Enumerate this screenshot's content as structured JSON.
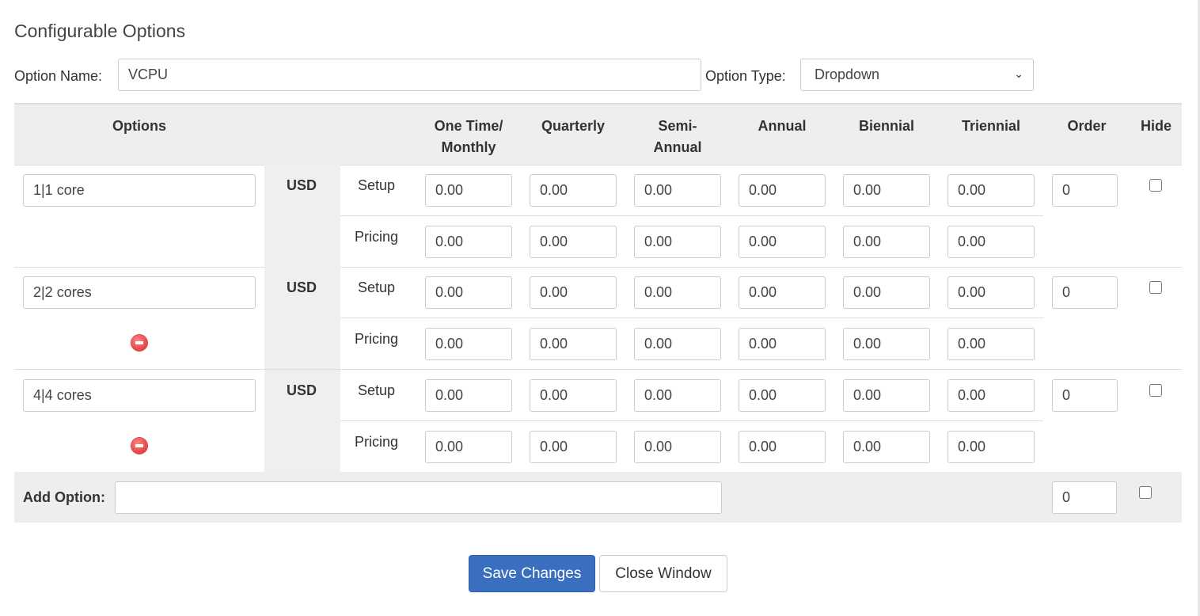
{
  "title": "Configurable Options",
  "option_name_label": "Option Name:",
  "option_name_value": "VCPU",
  "option_type_label": "Option Type:",
  "option_type_value": "Dropdown",
  "headers": {
    "options": "Options",
    "one_time": "One Time/ Monthly",
    "quarterly": "Quarterly",
    "semi": "Semi- Annual",
    "annual": "Annual",
    "biennial": "Biennial",
    "triennial": "Triennial",
    "order": "Order",
    "hide": "Hide"
  },
  "rows": [
    {
      "name": "1|1 core",
      "currency": "USD",
      "setup_label": "Setup",
      "pricing_label": "Pricing",
      "setup": [
        "0.00",
        "0.00",
        "0.00",
        "0.00",
        "0.00",
        "0.00"
      ],
      "pricing": [
        "0.00",
        "0.00",
        "0.00",
        "0.00",
        "0.00",
        "0.00"
      ],
      "order": "0",
      "hide": false,
      "deletable": false
    },
    {
      "name": "2|2 cores",
      "currency": "USD",
      "setup_label": "Setup",
      "pricing_label": "Pricing",
      "setup": [
        "0.00",
        "0.00",
        "0.00",
        "0.00",
        "0.00",
        "0.00"
      ],
      "pricing": [
        "0.00",
        "0.00",
        "0.00",
        "0.00",
        "0.00",
        "0.00"
      ],
      "order": "0",
      "hide": false,
      "deletable": true
    },
    {
      "name": "4|4 cores",
      "currency": "USD",
      "setup_label": "Setup",
      "pricing_label": "Pricing",
      "setup": [
        "0.00",
        "0.00",
        "0.00",
        "0.00",
        "0.00",
        "0.00"
      ],
      "pricing": [
        "0.00",
        "0.00",
        "0.00",
        "0.00",
        "0.00",
        "0.00"
      ],
      "order": "0",
      "hide": false,
      "deletable": true
    }
  ],
  "add_option": {
    "label": "Add Option:",
    "value": "",
    "order": "0",
    "hide": false
  },
  "buttons": {
    "save": "Save Changes",
    "close": "Close Window"
  },
  "colors": {
    "primary": "#3a6fc0",
    "delete": "#d22"
  }
}
